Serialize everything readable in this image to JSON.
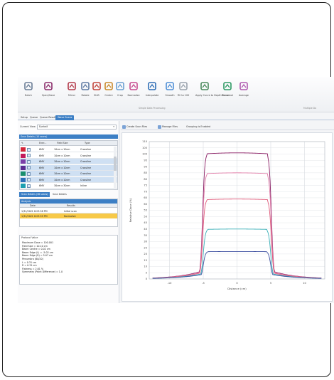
{
  "ribbon": {
    "buttons": [
      {
        "label": "Batch",
        "icon": "batch-icon"
      },
      {
        "label": "Open/Save",
        "icon": "open-save-icon"
      },
      {
        "label": "Mirror",
        "icon": "mirror-icon"
      },
      {
        "label": "Rotate",
        "icon": "rotate-icon"
      },
      {
        "label": "Shift",
        "icon": "shift-icon"
      },
      {
        "label": "Centre",
        "icon": "centre-icon"
      },
      {
        "label": "Crop",
        "icon": "crop-icon"
      },
      {
        "label": "Normalize",
        "icon": "normalize-icon"
      },
      {
        "label": "Interpolate",
        "icon": "interpolate-icon"
      },
      {
        "label": "Smooth",
        "icon": "smooth-icon"
      },
      {
        "label": "Fill to 100",
        "icon": "fill-icon"
      },
      {
        "label": "Apply Curve to Depth Curve",
        "icon": "curve-icon"
      },
      {
        "label": "Renormal",
        "icon": "renormal-icon"
      },
      {
        "label": "Average",
        "icon": "average-icon"
      }
    ],
    "group_label": "Simple Data Processing",
    "group_label_2": "Multiple Da"
  },
  "tabs": [
    "Setup",
    "Queue",
    "Queue Results",
    "Wave Scans"
  ],
  "left": {
    "current_view_label": "Current View",
    "current_view_value": "Eyeball",
    "scan_header": "Scan Details (10 scans)",
    "grid_headers": [
      "Ener...",
      "Field Size",
      "Type"
    ],
    "rows": [
      {
        "color": "#d3263a",
        "energy": "6MV",
        "field": "10cm x 10cm",
        "type": "Crossline"
      },
      {
        "color": "#c2185b",
        "energy": "6MV",
        "field": "10cm x 10cm",
        "type": "Crossline"
      },
      {
        "color": "#7b3fa8",
        "energy": "6MV",
        "field": "10cm x 10cm",
        "type": "Crossline"
      },
      {
        "color": "#5a2c91",
        "energy": "6MV",
        "field": "10cm x 10cm",
        "type": "Crossline"
      },
      {
        "color": "#1a8f6e",
        "energy": "6MV",
        "field": "10cm x 10cm",
        "type": "Crossline"
      },
      {
        "color": "#2a6fb8",
        "energy": "6MV",
        "field": "10cm x 10cm",
        "type": "Crossline"
      },
      {
        "color": "#1c9fb0",
        "energy": "6MV",
        "field": "30cm x 30cm",
        "type": "Inline"
      }
    ],
    "subtabs": [
      "Scan Details (38 scans)",
      "Scan Details"
    ],
    "history_header": "Analysis",
    "history_cols": [
      "Date",
      "Results"
    ],
    "history_rows": [
      {
        "date": "1/31/2021 8:23:58 PM",
        "result": "Initial scan"
      },
      {
        "date": "1/31/2021 8:23:59 PM",
        "result": "Normalize"
      }
    ],
    "analysis_tabs": "Protocol   Value",
    "analysis_lines": [
      "Maximum Dose = 100.001",
      "Field Size = 10.10 cm",
      "Beam Centre = 0.02 cm",
      "Beam Edge (L) = -5.02 cm",
      "Beam Edge (R) = 5.07 cm",
      "Penumbra (80/20)",
      "L = 0.31 cm",
      "R = 0.31 cm",
      "Flatness = 2.61 %",
      "Symmetry (Point Difference) = 1.0"
    ]
  },
  "right": {
    "toolbar": [
      "Create Scan Files",
      "Manage Files",
      "Grouping is Enabled"
    ]
  },
  "chart_data": {
    "type": "line",
    "xlabel": "Distance (cm)",
    "ylabel": "Relative Dose (%)",
    "xlim": [
      -13,
      13
    ],
    "ylim": [
      0,
      110
    ],
    "x_ticks": [
      -10,
      -5,
      0,
      5,
      10
    ],
    "y_ticks": [
      0,
      5,
      10,
      15,
      20,
      25,
      30,
      35,
      40,
      45,
      50,
      55,
      60,
      65,
      70,
      75,
      80,
      85,
      90,
      95,
      100,
      105,
      110
    ],
    "grid": true,
    "series": [
      {
        "color": "#8a1c63",
        "plateau": 101,
        "edge": 5.1
      },
      {
        "color": "#e07ca8",
        "plateau": 85,
        "edge": 5.1
      },
      {
        "color": "#e05a7a",
        "plateau": 64,
        "edge": 5.1
      },
      {
        "color": "#3bb0b8",
        "plateau": 40,
        "edge": 5.0
      },
      {
        "color": "#3c4fa0",
        "plateau": 22,
        "edge": 5.0
      }
    ]
  }
}
